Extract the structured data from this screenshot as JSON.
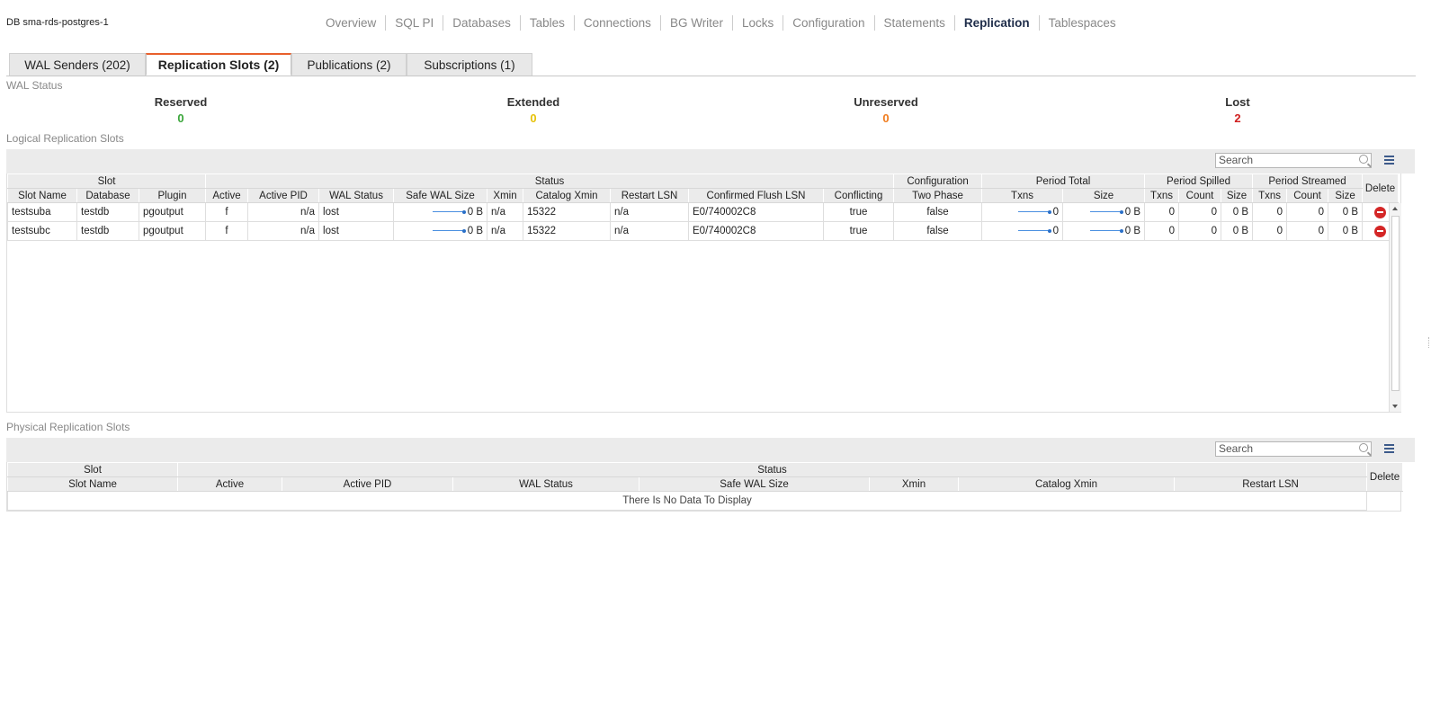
{
  "db_title": "DB sma-rds-postgres-1",
  "nav": [
    "Overview",
    "SQL PI",
    "Databases",
    "Tables",
    "Connections",
    "BG Writer",
    "Locks",
    "Configuration",
    "Statements",
    "Replication",
    "Tablespaces"
  ],
  "nav_active": "Replication",
  "tabs": [
    "WAL Senders (202)",
    "Replication Slots (2)",
    "Publications (2)",
    "Subscriptions (1)"
  ],
  "tab_active": "Replication Slots (2)",
  "wal_status": {
    "title": "WAL Status",
    "items": [
      {
        "label": "Reserved",
        "value": "0",
        "color": "#3aa63a"
      },
      {
        "label": "Extended",
        "value": "0",
        "color": "#e6c20a"
      },
      {
        "label": "Unreserved",
        "value": "0",
        "color": "#f07c1e"
      },
      {
        "label": "Lost",
        "value": "2",
        "color": "#d02020"
      }
    ]
  },
  "logical": {
    "title": "Logical Replication Slots",
    "search_placeholder": "Search",
    "groups": [
      "Slot",
      "Status",
      "Configuration",
      "Period Total",
      "Period Spilled",
      "Period Streamed",
      "Delete"
    ],
    "columns": [
      "Slot Name",
      "Database",
      "Plugin",
      "Active",
      "Active PID",
      "WAL Status",
      "Safe WAL Size",
      "Xmin",
      "Catalog Xmin",
      "Restart LSN",
      "Confirmed Flush LSN",
      "Conflicting",
      "Two Phase",
      "Txns",
      "Size",
      "Txns",
      "Count",
      "Size",
      "Txns",
      "Count",
      "Size"
    ],
    "rows": [
      {
        "slot_name": "testsuba",
        "database": "testdb",
        "plugin": "pgoutput",
        "active": "f",
        "active_pid": "n/a",
        "wal_status": "lost",
        "safe_wal_size": "0 B",
        "xmin": "n/a",
        "catalog_xmin": "15322",
        "restart_lsn": "n/a",
        "confirmed_flush_lsn": "E0/740002C8",
        "conflicting": "true",
        "two_phase": "false",
        "total_txns": "0",
        "total_size": "0 B",
        "spilled_txns": "0",
        "spilled_count": "0",
        "spilled_size": "0 B",
        "streamed_txns": "0",
        "streamed_count": "0",
        "streamed_size": "0 B"
      },
      {
        "slot_name": "testsubc",
        "database": "testdb",
        "plugin": "pgoutput",
        "active": "f",
        "active_pid": "n/a",
        "wal_status": "lost",
        "safe_wal_size": "0 B",
        "xmin": "n/a",
        "catalog_xmin": "15322",
        "restart_lsn": "n/a",
        "confirmed_flush_lsn": "E0/740002C8",
        "conflicting": "true",
        "two_phase": "false",
        "total_txns": "0",
        "total_size": "0 B",
        "spilled_txns": "0",
        "spilled_count": "0",
        "spilled_size": "0 B",
        "streamed_txns": "0",
        "streamed_count": "0",
        "streamed_size": "0 B"
      }
    ]
  },
  "physical": {
    "title": "Physical Replication Slots",
    "search_placeholder": "Search",
    "groups": [
      "Slot",
      "Status",
      "Delete"
    ],
    "columns": [
      "Slot Name",
      "Active",
      "Active PID",
      "WAL Status",
      "Safe WAL Size",
      "Xmin",
      "Catalog Xmin",
      "Restart LSN"
    ],
    "empty_text": "There Is No Data To Display"
  },
  "colors": {
    "accent_tab": "#e8602c",
    "nav_active": "#1f2d4a",
    "delete": "#d42626",
    "sparkline": "#4a8fe0"
  }
}
